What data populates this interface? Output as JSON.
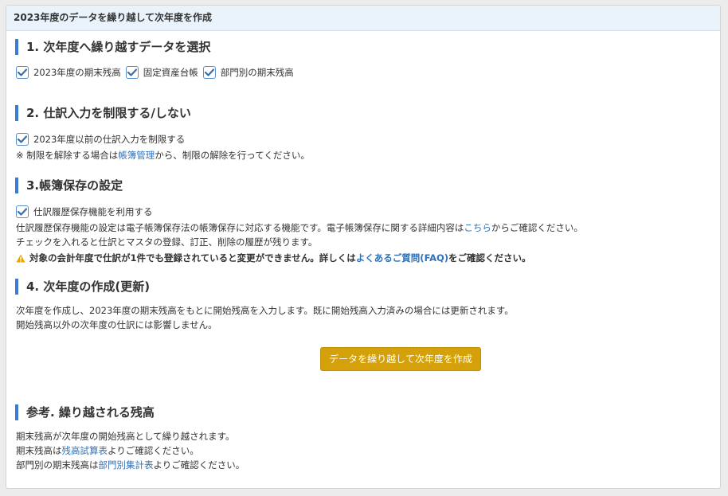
{
  "header": {
    "title": "2023年度のデータを繰り越して次年度を作成"
  },
  "section1": {
    "heading": "1. 次年度へ繰り越すデータを選択",
    "options": [
      {
        "label": "2023年度の期末残高",
        "checked": true
      },
      {
        "label": "固定資産台帳",
        "checked": true
      },
      {
        "label": "部門別の期末残高",
        "checked": true
      }
    ]
  },
  "section2": {
    "heading": "2. 仕訳入力を制限する/しない",
    "option": {
      "label": "2023年度以前の仕訳入力を制限する",
      "checked": true
    },
    "note_prefix": "※ 制限を解除する場合は",
    "note_link": "帳簿管理",
    "note_suffix": "から、制限の解除を行ってください。"
  },
  "section3": {
    "heading": "3.帳簿保存の設定",
    "option": {
      "label": "仕訳履歴保存機能を利用する",
      "checked": true
    },
    "desc1_prefix": "仕訳履歴保存機能の設定は電子帳簿保存法の帳簿保存に対応する機能です。電子帳簿保存に関する詳細内容は",
    "desc1_link": "こちら",
    "desc1_suffix": "からご確認ください。",
    "desc2": "チェックを入れると仕訳とマスタの登録、訂正、削除の履歴が残ります。",
    "warning_prefix": "対象の会計年度で仕訳が1件でも登録されていると変更ができません。詳しくは",
    "warning_link": "よくあるご質問(FAQ)",
    "warning_suffix": "をご確認ください。"
  },
  "section4": {
    "heading": "4. 次年度の作成(更新)",
    "desc1": "次年度を作成し、2023年度の期末残高をもとに開始残高を入力します。既に開始残高入力済みの場合には更新されます。",
    "desc2": "開始残高以外の次年度の仕訳には影響しません。",
    "button_label": "データを繰り越して次年度を作成"
  },
  "section5": {
    "heading": "参考. 繰り越される残高",
    "line1": "期末残高が次年度の開始残高として繰り越されます。",
    "line2_prefix": "期末残高は",
    "line2_link": "残高試算表",
    "line2_suffix": "よりご確認ください。",
    "line3_prefix": "部門別の期末残高は",
    "line3_link": "部門別集計表",
    "line3_suffix": "よりご確認ください。"
  },
  "colors": {
    "accent_bar": "#3a7bd5",
    "link": "#2f72b8",
    "primary_button": "#d4a10a",
    "warning_icon": "#e6a800",
    "header_bg": "#eaf3fc"
  }
}
